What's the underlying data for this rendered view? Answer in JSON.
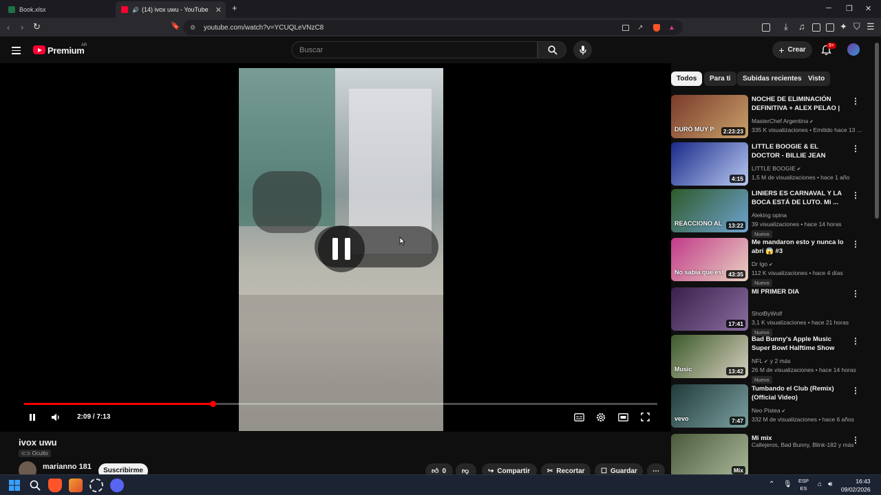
{
  "browser": {
    "tabs": [
      {
        "label": "Book.xlsx",
        "active": false
      },
      {
        "label": "(14) ivox uwu - YouTube",
        "active": true
      }
    ],
    "url": "youtube.com/watch?v=YCUQLeVNzC8"
  },
  "masthead": {
    "brand": "Premium",
    "region": "AR",
    "search_placeholder": "Buscar",
    "create_label": "Crear",
    "notifications_badge": "9+"
  },
  "player": {
    "time_display": "2:09 / 7:13",
    "progress_fraction": 0.298,
    "state": "playing"
  },
  "video_info": {
    "title": "ivox uwu",
    "privacy": "Oculto",
    "channel": "marianno 181",
    "subscribe_label": "Suscribirme",
    "likes": "0",
    "share_label": "Compartir",
    "clip_label": "Recortar",
    "save_label": "Guardar"
  },
  "sidebar": {
    "chips": [
      {
        "label": "Todos",
        "active": true
      },
      {
        "label": "Para ti",
        "active": false
      },
      {
        "label": "Subidas recientes",
        "active": false
      },
      {
        "label": "Visto",
        "active": false
      }
    ],
    "recommendations": [
      {
        "title": "NOCHE DE ELIMINACIÓN DEFINITIVA + ALEX PELAO | ...",
        "channel": "MasterChef Argentina",
        "verified": true,
        "meta": "335 K visualizaciones • Emitido hace 13 ...",
        "duration": "2:23:23",
        "new": "",
        "thumb_text": "DURÓ MUY P",
        "colors": [
          "#7a3b2a",
          "#c9a16a"
        ]
      },
      {
        "title": "LITTLE BOOGIE & EL DOCTOR - BILLIE JEAN (VIDEOCLIP ...",
        "channel": "LITTLE BOOGIE",
        "verified": true,
        "meta": "1,5 M de visualizaciones • hace 1 año",
        "duration": "4:15",
        "new": "",
        "thumb_text": "",
        "colors": [
          "#1a2a8a",
          "#b8c8f0"
        ]
      },
      {
        "title": "LINIERS ES CARNAVAL Y LA BOCA ESTÁ DE LUTO. Mi ...",
        "channel": "Aleking opina",
        "verified": false,
        "meta": "39 visualizaciones • hace 14 horas",
        "duration": "13:22",
        "new": "Nuevo",
        "thumb_text": "REACCIONO AL FORTIN",
        "colors": [
          "#2e5a2a",
          "#6fa3d1"
        ]
      },
      {
        "title": "Me mandaron esto y nunca lo abrí 😱 #3",
        "channel": "Dr Igo",
        "verified": true,
        "meta": "112 K visualizaciones • hace 4 días",
        "duration": "43:35",
        "new": "Nuevo",
        "thumb_text": "No sabía que esto existía...",
        "colors": [
          "#c23a8a",
          "#e8d2c0"
        ]
      },
      {
        "title": "MI PRIMER DIA",
        "channel": "ShotByWolf",
        "verified": false,
        "meta": "3,1 K visualizaciones • hace 21 horas",
        "duration": "17:41",
        "new": "Nuevo",
        "thumb_text": "",
        "colors": [
          "#3a1f4a",
          "#8a6fa0"
        ]
      },
      {
        "title": "Bad Bunny's Apple Music Super Bowl Halftime Show",
        "channel": "NFL",
        "verified": true,
        "channel_suffix": "y 2 más",
        "meta": "26 M de visualizaciones • hace 14 horas",
        "duration": "13:42",
        "new": "Nuevo",
        "thumb_text": "Music",
        "colors": [
          "#3c5a2a",
          "#d8d0c0"
        ]
      },
      {
        "title": "Tumbando el Club (Remix) (Official Video)",
        "channel": "Neo Pistea",
        "verified": true,
        "meta": "332 M de visualizaciones • hace 6 años",
        "duration": "7:47",
        "new": "",
        "thumb_text": "vevo",
        "colors": [
          "#223a3a",
          "#7aa0a0"
        ]
      },
      {
        "title": "Mi mix",
        "channel": "",
        "verified": false,
        "meta": "Callejeros, Bad Bunny, Blink-182 y más",
        "duration": "Mix",
        "new": "",
        "thumb_text": "",
        "colors": [
          "#4a5a3a",
          "#a8b898"
        ]
      }
    ]
  },
  "taskbar": {
    "lang_top": "ESP",
    "lang_bottom": "ES",
    "time": "16:43",
    "date": "09/02/2026"
  }
}
